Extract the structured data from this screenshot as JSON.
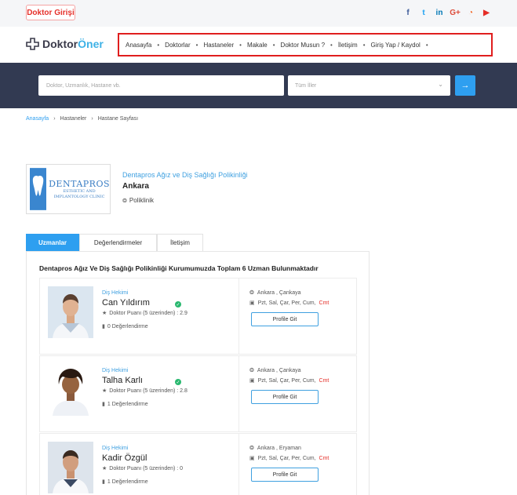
{
  "topbar": {
    "login_label": "Doktor Girişi",
    "social_icons": [
      "facebook-icon",
      "twitter-icon",
      "linkedin-icon",
      "google-plus-icon",
      "rss-icon",
      "youtube-icon"
    ],
    "social_glyphs": [
      "f",
      "t",
      "in",
      "G+",
      "◔",
      "▶"
    ],
    "social_colors": [
      "#3b5998",
      "#1da1f2",
      "#0077b5",
      "#dd4b39",
      "#f26522",
      "#e52d27"
    ]
  },
  "header": {
    "logo_main": "Doktor",
    "logo_accent": "Öner",
    "nav": [
      "Anasayfa",
      "Doktorlar",
      "Hastaneler",
      "Makale",
      "Doktor Musun ?",
      "İletişim",
      "Giriş Yap / Kaydol"
    ]
  },
  "search": {
    "placeholder": "Doktor, Uzmanlık, Hastane vb.",
    "city_value": "Tüm İller"
  },
  "breadcrumb": [
    "Anasayfa",
    "Hastaneler",
    "Hastane Sayfası"
  ],
  "clinic": {
    "logo_word": "DENTAPROS",
    "logo_sub1": "ESTHETIC AND",
    "logo_sub2": "IMPLANTOLOGY CLINIC",
    "name": "Dentapros Ağız ve Diş Sağlığı Polikinliği",
    "city": "Ankara",
    "type": "Poliklinik"
  },
  "tabs": [
    "Uzmanlar",
    "Değerlendirmeler",
    "İletişim"
  ],
  "panel": {
    "title": "Dentapros Ağız Ve Diş Sağlığı Polikinliği Kurumumuzda Toplam 6 Uzman Bulunmaktadır"
  },
  "doctors": [
    {
      "specialty": "Diş Hekimi",
      "name": "Can Yıldırım",
      "score": "Doktor Puanı (5 üzerinden) : 2.9",
      "reviews": "0 Değerlendirme",
      "location": "Ankara , Çankaya",
      "days": "Pzt, Sal, Çar, Per, Cum,",
      "days_highlight": "Cmt",
      "button": "Profile Git",
      "verified": true
    },
    {
      "specialty": "Diş Hekimi",
      "name": "Talha Karlı",
      "score": "Doktor Puanı (5 üzerinden) : 2.8",
      "reviews": "1 Değerlendirme",
      "location": "Ankara , Çankaya",
      "days": "Pzt, Sal, Çar, Per, Cum,",
      "days_highlight": "Cmt",
      "button": "Profile Git",
      "verified": true
    },
    {
      "specialty": "Diş Hekimi",
      "name": "Kadir Özgül",
      "score": "Doktor Puanı (5 üzerinden) : 0",
      "reviews": "1 Değerlendirme",
      "location": "Ankara , Eryaman",
      "days": "Pzt, Sal, Çar, Per, Cum,",
      "days_highlight": "Cmt",
      "button": "Profile Git",
      "verified": false
    }
  ]
}
